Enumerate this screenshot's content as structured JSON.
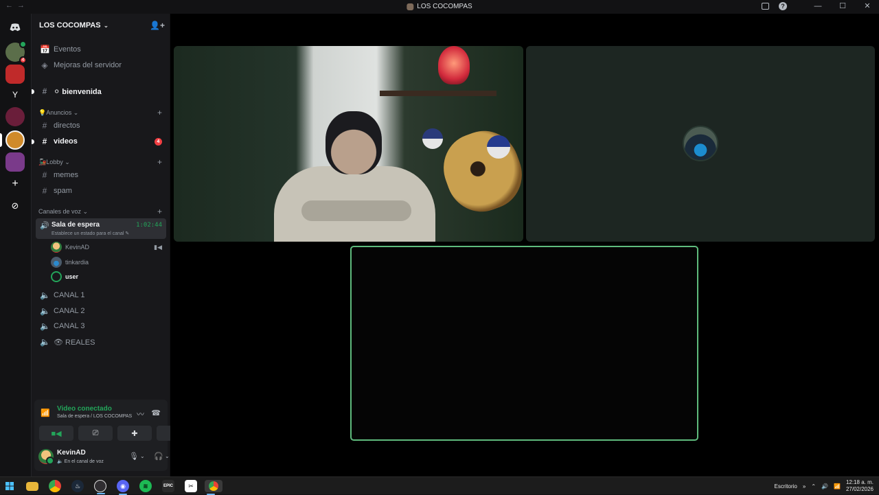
{
  "window": {
    "title": "LOS COCOMPAS",
    "back": "←",
    "forward": "→",
    "inbox_icon": "inbox-icon",
    "help_icon": "?",
    "minimize": "—",
    "maximize": "☐",
    "close": "✕"
  },
  "guilds": {
    "home_icon": "discord-icon",
    "items": [
      {
        "label": "",
        "badge": "4",
        "color": "#5b6e4a",
        "status": true
      },
      {
        "label": "",
        "badge": "",
        "color": "#c02a2a"
      },
      {
        "label": "Y",
        "badge": "",
        "color": "#121214"
      },
      {
        "label": "",
        "badge": "",
        "color": "#6a1e3a"
      },
      {
        "label": "",
        "badge": "",
        "color": "#d08a2a"
      },
      {
        "label": "",
        "badge": "",
        "color": "#7a3a8a"
      }
    ],
    "add_label": "+",
    "explore_label": "⊘"
  },
  "server": {
    "name": "LOS COCOMPAS",
    "chevron": "⌄",
    "invite_icon": "add-member-icon"
  },
  "sidebar": {
    "top": [
      {
        "label": "Eventos",
        "icon": "📅"
      },
      {
        "label": "Mejoras del servidor",
        "icon": "◈"
      }
    ],
    "welcome": {
      "label": "⚪ bienvenida",
      "icon": "#"
    },
    "categories": [
      {
        "label": "💡Anuncios ⌄",
        "channels": [
          {
            "label": "directos",
            "unread": false,
            "badge": ""
          },
          {
            "label": "videos",
            "unread": true,
            "badge": "4"
          }
        ]
      },
      {
        "label": "🚂Lobby ⌄",
        "channels": [
          {
            "label": "memes"
          },
          {
            "label": "spam"
          }
        ]
      },
      {
        "label": "Canales de voz ⌄"
      }
    ],
    "plus": "+",
    "voice_active": {
      "name": "Sala de espera",
      "timer": "1:02:44",
      "sub": "Establece un estado para el canal ✎"
    },
    "voice_users": [
      {
        "name": "KevinAD",
        "camera": "▮◀"
      },
      {
        "name": "tinkardia"
      },
      {
        "name": "user"
      }
    ],
    "voice_channels": [
      "CANAL 1",
      "CANAL 2",
      "CANAL 3",
      "👁 REALES"
    ]
  },
  "rtc": {
    "title": "Video conectado",
    "sub": "Sala de espera / LOS COCOMPAS",
    "buttons": [
      "camera-icon",
      "screen-share-icon",
      "activities-icon",
      "soundboard-icon"
    ]
  },
  "user_panel": {
    "name": "KevinAD",
    "status": "🔈 En el canal de voz"
  },
  "taskbar": {
    "apps": [
      "start-icon",
      "explorer-icon",
      "chrome-icon",
      "steam-icon",
      "obs-icon",
      "discord-icon",
      "spotify-icon",
      "epic-icon",
      "capcut-icon",
      "chrome-icon-2"
    ],
    "epic_label": "EPIC",
    "desktop_label": "Escritorio",
    "time": "12:18 a. m.",
    "date": "27/02/2026"
  }
}
